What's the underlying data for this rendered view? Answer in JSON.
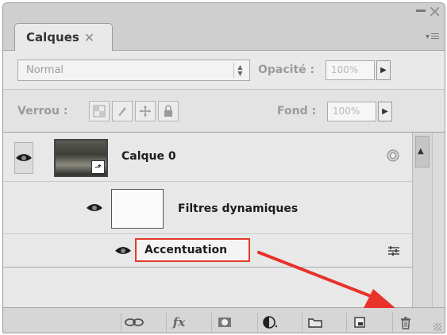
{
  "panel": {
    "tab_label": "Calques",
    "tab_close": "✕"
  },
  "blend": {
    "mode": "Normal",
    "opacity_label": "Opacité :",
    "opacity_value": "100%"
  },
  "lock": {
    "label": "Verrou :",
    "fill_label": "Fond :",
    "fill_value": "100%"
  },
  "layers": [
    {
      "name": "Calque 0"
    },
    {
      "name": "Filtres dynamiques"
    },
    {
      "name": "Accentuation"
    }
  ],
  "footer": {
    "fx_label": "fx"
  },
  "colors": {
    "highlight": "#e23a2a",
    "arrow": "#e8322a"
  }
}
